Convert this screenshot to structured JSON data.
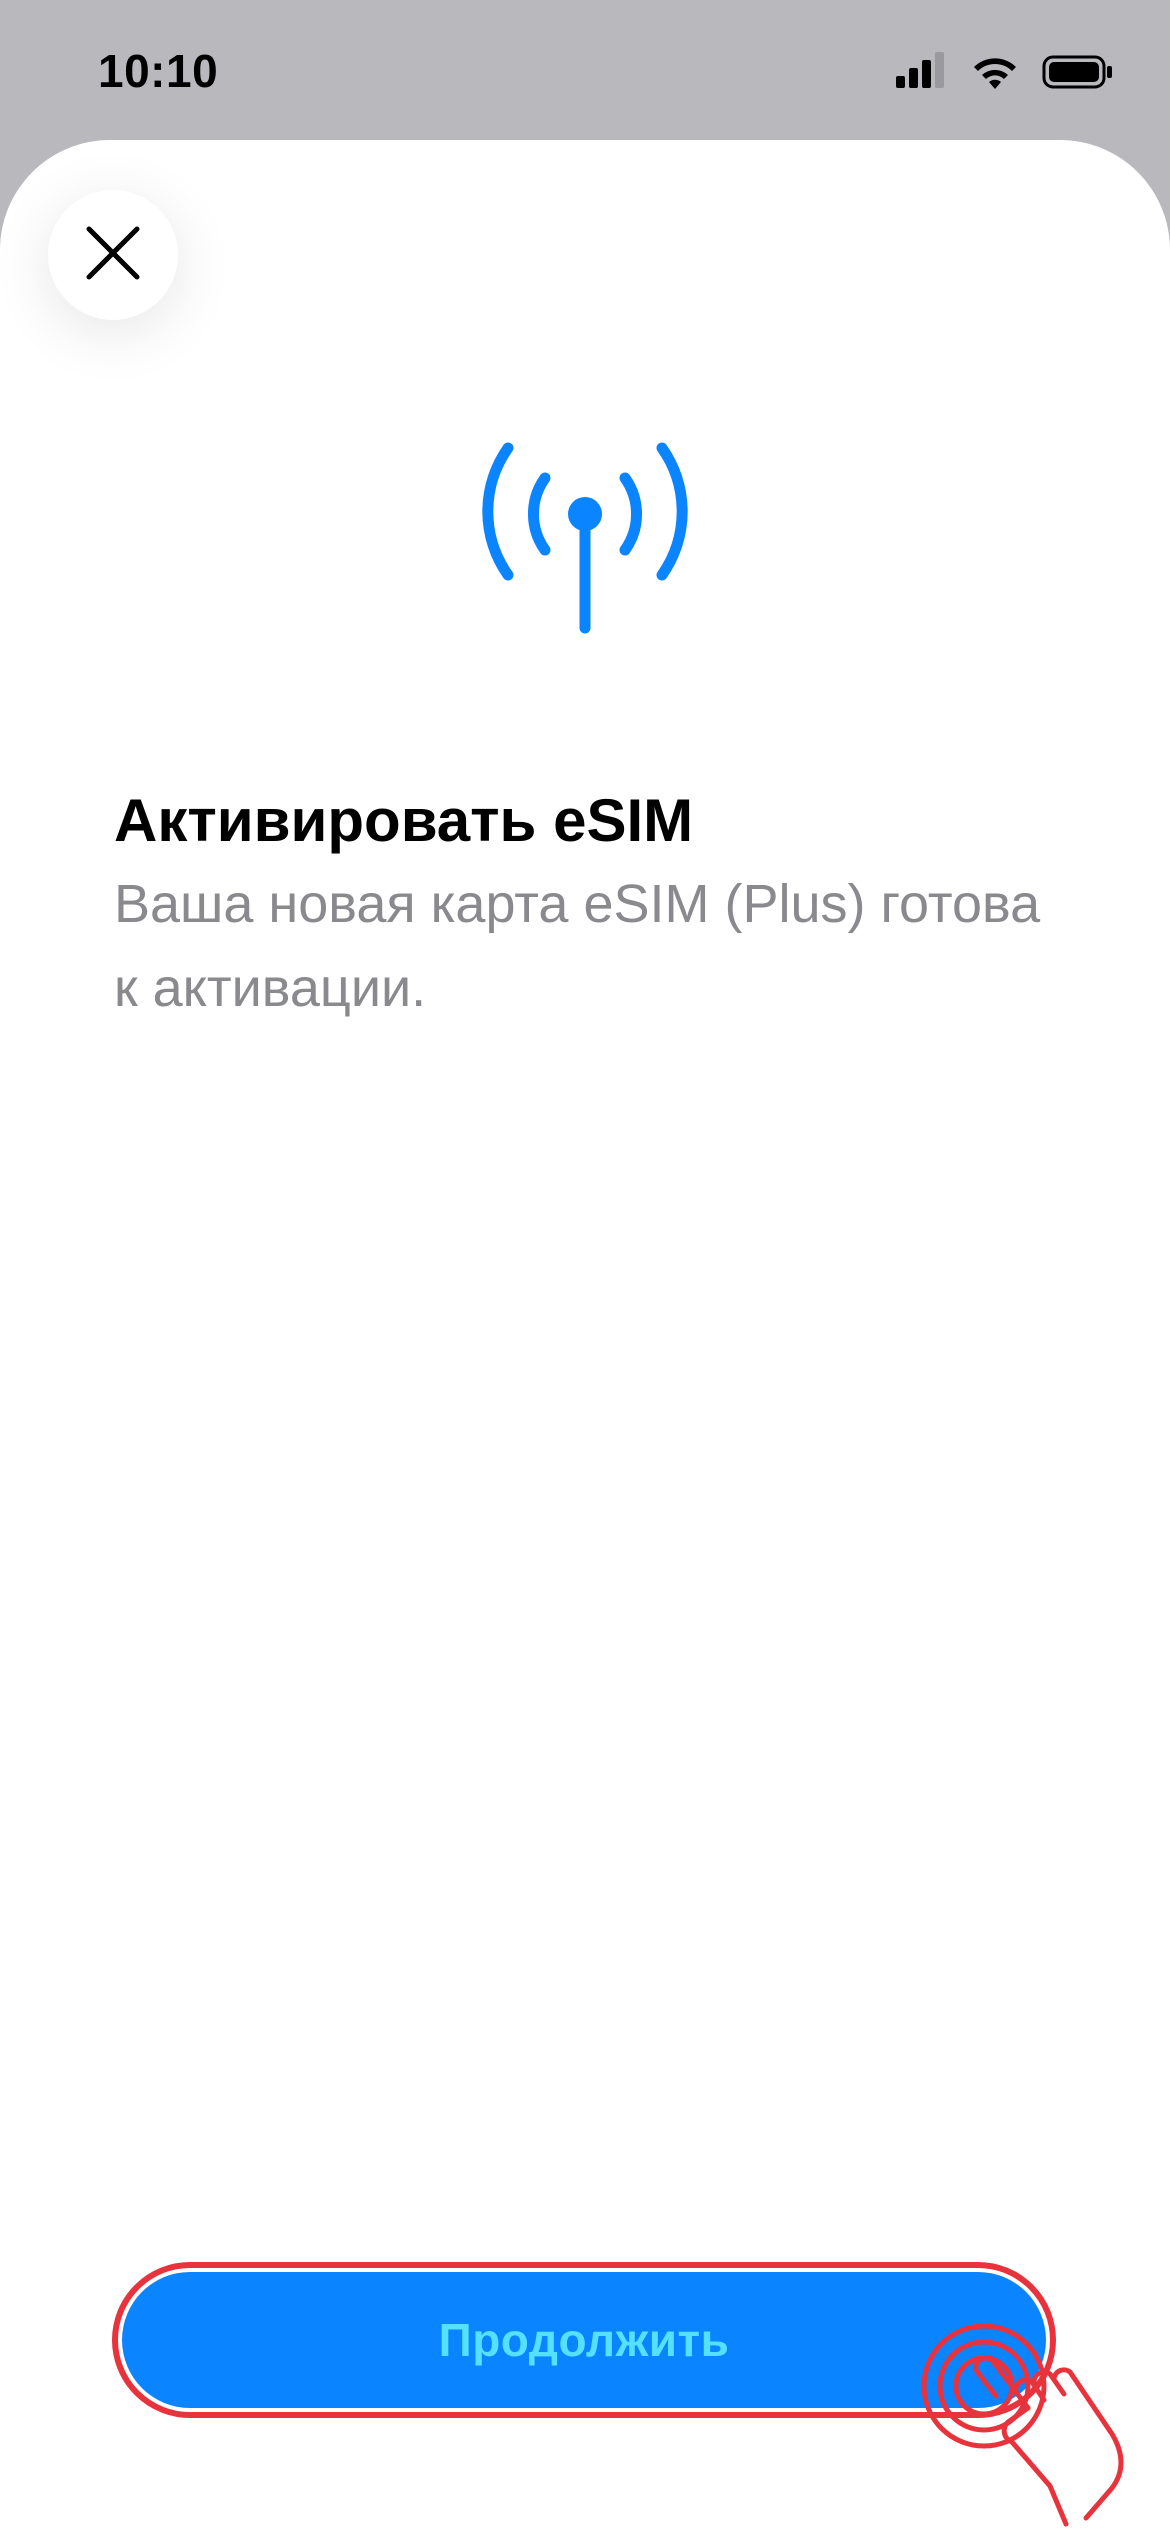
{
  "status_bar": {
    "time": "10:10",
    "icons": [
      "signal-icon",
      "wifi-icon",
      "battery-icon"
    ]
  },
  "sheet": {
    "close_icon": "close-icon",
    "hero_icon": "antenna-broadcast-icon",
    "title": "Активировать eSIM",
    "subtitle": "Ваша новая карта eSIM (Plus) готова к активации.",
    "continue_label": "Продолжить"
  },
  "colors": {
    "accent": "#0A84FF",
    "button_text": "#55E0FF",
    "highlight": "#E8323C",
    "subtitle": "#8A8A8E"
  }
}
